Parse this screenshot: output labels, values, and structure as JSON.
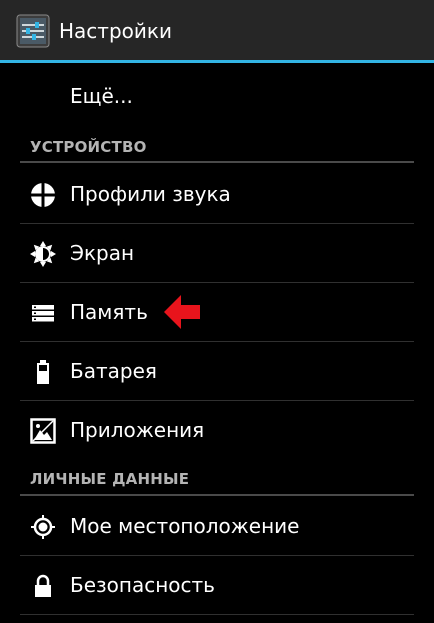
{
  "app": {
    "title": "Настройки",
    "icon": "settings-sliders-icon",
    "accent_color": "#33b5e5",
    "background_color": "#000000"
  },
  "list": {
    "more_item": {
      "label": "Ещё..."
    },
    "device_section": {
      "header": "УСТРОЙСТВО",
      "items": [
        {
          "label": "Профили звука",
          "icon": "sound-profiles-icon"
        },
        {
          "label": "Экран",
          "icon": "display-brightness-icon"
        },
        {
          "label": "Память",
          "icon": "storage-icon"
        },
        {
          "label": "Батарея",
          "icon": "battery-icon"
        },
        {
          "label": "Приложения",
          "icon": "apps-icon"
        }
      ]
    },
    "personal_section": {
      "header": "ЛИЧНЫЕ ДАННЫЕ",
      "items": [
        {
          "label": "Мое местоположение",
          "icon": "location-icon"
        },
        {
          "label": "Безопасность",
          "icon": "lock-icon"
        }
      ]
    }
  },
  "annotation": {
    "arrow_icon": "red-arrow-icon",
    "arrow_color": "#e8141c"
  }
}
